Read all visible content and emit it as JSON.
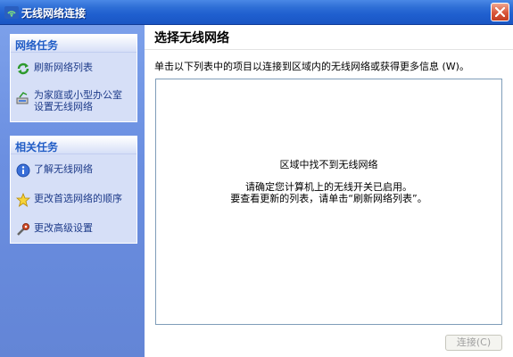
{
  "window": {
    "title": "无线网络连接"
  },
  "sidebar": {
    "network_tasks": {
      "header": "网络任务",
      "items": [
        {
          "label": "刷新网络列表",
          "icon": "refresh-icon"
        },
        {
          "label": "为家庭或小型办公室设置无线网络",
          "icon": "network-setup-icon"
        }
      ]
    },
    "related_tasks": {
      "header": "相关任务",
      "items": [
        {
          "label": "了解无线网络",
          "icon": "info-icon"
        },
        {
          "label": "更改首选网络的顺序",
          "icon": "star-icon"
        },
        {
          "label": "更改高级设置",
          "icon": "settings-icon"
        }
      ]
    }
  },
  "main": {
    "title": "选择无线网络",
    "description": "单击以下列表中的项目以连接到区域内的无线网络或获得更多信息 (W)。",
    "list": {
      "empty_title": "区域中找不到无线网络",
      "empty_line1": "请确定您计算机上的无线开关已启用。",
      "empty_line2": "要查看更新的列表，请单击“刷新网络列表”。"
    },
    "connect_button": "连接(C)"
  },
  "colors": {
    "titlebar": "#2f6fd6",
    "sidebar_bg": "#6b8fe1",
    "group_bg": "#d6dff7",
    "group_header_text": "#215dc6"
  }
}
